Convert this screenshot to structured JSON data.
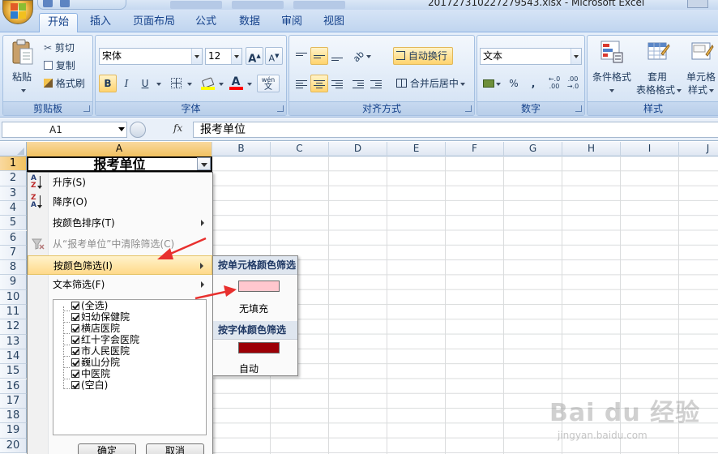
{
  "window": {
    "title": "2017273102272795​43.xlsx - Microsoft Excel"
  },
  "ribbon": {
    "tabs": [
      "开始",
      "插入",
      "页面布局",
      "公式",
      "数据",
      "审阅",
      "视图"
    ],
    "active_tab": "开始",
    "clipboard": {
      "paste": "粘贴",
      "cut": "剪切",
      "copy": "复制",
      "format_painter": "格式刷",
      "label": "剪贴板"
    },
    "font": {
      "name": "宋体",
      "size": "12",
      "grow": "A",
      "shrink": "A",
      "bold": "B",
      "italic": "I",
      "underline": "U",
      "color_letter": "A",
      "phonetic": "wén",
      "phonetic_char": "文",
      "label": "字体"
    },
    "alignment": {
      "wrap_text": "自动换行",
      "merge_center": "合并后居中",
      "label": "对齐方式"
    },
    "number": {
      "format": "文本",
      "percent": "%",
      "comma": ",",
      "label": "数字"
    },
    "styles": {
      "conditional": "条件格式",
      "as_table_line1": "套用",
      "as_table_line2": "表格格式",
      "cell_styles_line1": "单元格",
      "cell_styles_line2": "样式",
      "label": "样式"
    }
  },
  "formula_bar": {
    "name_box": "A1",
    "fx": "fx",
    "content": "报考单位"
  },
  "sheet": {
    "columns": [
      "A",
      "B",
      "C",
      "D",
      "E",
      "F",
      "G",
      "H",
      "I",
      "J"
    ],
    "rows": [
      "1",
      "2",
      "3",
      "4",
      "5",
      "6",
      "7",
      "8",
      "9",
      "10",
      "11",
      "12",
      "13",
      "14",
      "15",
      "16",
      "17",
      "18",
      "19",
      "20"
    ],
    "a1_value": "报考单位"
  },
  "filter_menu": {
    "items": [
      {
        "label": "升序(S)"
      },
      {
        "label": "降序(O)"
      },
      {
        "label": "按颜色排序(T)"
      },
      {
        "label": "从“报考单位”中清除筛选(C)"
      },
      {
        "label": "按颜色筛选(I)"
      },
      {
        "label": "文本筛选(F)"
      }
    ],
    "list": [
      "(全选)",
      "妇幼保健院",
      "横店医院",
      "红十字会医院",
      "市人民医院",
      "巍山分院",
      "中医院",
      "(空白)"
    ],
    "ok": "确定",
    "cancel": "取消"
  },
  "color_submenu": {
    "cell_header": "按单元格颜色筛选",
    "cell_swatch_color": "#ffc7ce",
    "no_fill": "无填充",
    "font_header": "按字体颜色筛选",
    "font_swatch_color": "#9c0006",
    "auto": "自动"
  },
  "watermark": {
    "brand": "Bai du 经验",
    "url": "jingyan.baidu.com"
  },
  "colors": {
    "accent": "#15428b",
    "annotation_red": "#e8302e",
    "selection": "#f1c15f"
  }
}
